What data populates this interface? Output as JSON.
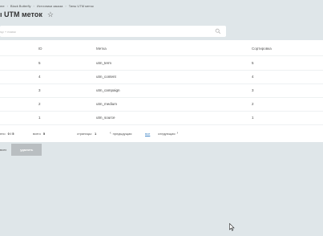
{
  "breadcrumb": {
    "items": [
      "me",
      "Black Butterfly",
      "Источники заказа",
      "Типы UTM меток"
    ]
  },
  "page": {
    "title": "ı UTM меток"
  },
  "search": {
    "placeholder": "ър + поиск"
  },
  "table": {
    "headers": [
      "",
      "ID",
      "Метка",
      "Сортировка"
    ],
    "rows": [
      {
        "check": "",
        "id": "5",
        "label": "utm_term",
        "sort": "5"
      },
      {
        "check": "",
        "id": "4",
        "label": "utm_content",
        "sort": "4"
      },
      {
        "check": "",
        "id": "3",
        "label": "utm_campaign",
        "sort": "3"
      },
      {
        "check": "",
        "id": "2",
        "label": "utm_medium",
        "sort": "2"
      },
      {
        "check": "",
        "id": "1",
        "label": "utm_source",
        "sort": "1"
      }
    ]
  },
  "footer": {
    "selected_label": "ено",
    "selected_value": "0 / 5",
    "total_label": "всего",
    "total_value": "5",
    "pages_label": "страницы:",
    "pages_value": "1",
    "prev": "предыдущая",
    "all": "все",
    "next": "следующая"
  },
  "actions": {
    "select_all": "всех",
    "delete": "удалить"
  },
  "icons": {
    "star": "star-icon",
    "search": "search-icon",
    "prev": "chevron-left-icon",
    "next": "chevron-right-icon",
    "cursor": "mouse-cursor-icon"
  }
}
